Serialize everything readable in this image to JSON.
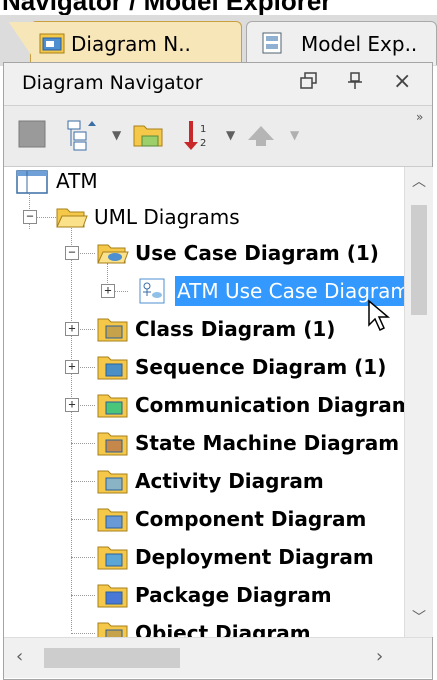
{
  "window": {
    "title": "Navigator / Model Explorer"
  },
  "tabs": [
    {
      "label": "Diagram N..",
      "active": true,
      "icon": "diagram-navigator-icon"
    },
    {
      "label": "Model Exp..",
      "active": false,
      "icon": "model-explorer-icon"
    }
  ],
  "panel": {
    "title": "Diagram Navigator",
    "buttons": [
      "restore-icon",
      "pin-icon",
      "close-icon"
    ],
    "close_glyph": "×",
    "pin_glyph": "ꟼ"
  },
  "toolbar": {
    "items": [
      "new-diagram-icon",
      "organize-icon",
      "open-folder-icon",
      "sort-icon",
      "up-arrow-icon"
    ]
  },
  "tree": {
    "root": "ATM",
    "uml_folder": "UML Diagrams",
    "use_case_group": "Use Case Diagram (1)",
    "selected_item": "ATM Use Case Diagram",
    "groups": [
      {
        "label": "Class Diagram (1)",
        "expandable": true,
        "icon_color": "#c6a34a"
      },
      {
        "label": "Sequence Diagram (1)",
        "expandable": true,
        "icon_color": "#4a90c6"
      },
      {
        "label": "Communication Diagram",
        "expandable": true,
        "icon_color": "#4ac67a"
      },
      {
        "label": "State Machine Diagram",
        "expandable": false,
        "icon_color": "#c6884a"
      },
      {
        "label": "Activity Diagram",
        "expandable": false,
        "icon_color": "#8ab4c6"
      },
      {
        "label": "Component Diagram",
        "expandable": false,
        "icon_color": "#6a9ad6"
      },
      {
        "label": "Deployment Diagram",
        "expandable": false,
        "icon_color": "#5aa6d6"
      },
      {
        "label": "Package Diagram",
        "expandable": false,
        "icon_color": "#4a78d6"
      },
      {
        "label": "Object Diagram",
        "expandable": false,
        "icon_color": "#c6a34a"
      }
    ]
  },
  "colors": {
    "selection": "#3399ff",
    "folder": "#f5c84a",
    "tab_active": "#f7e7b8"
  }
}
